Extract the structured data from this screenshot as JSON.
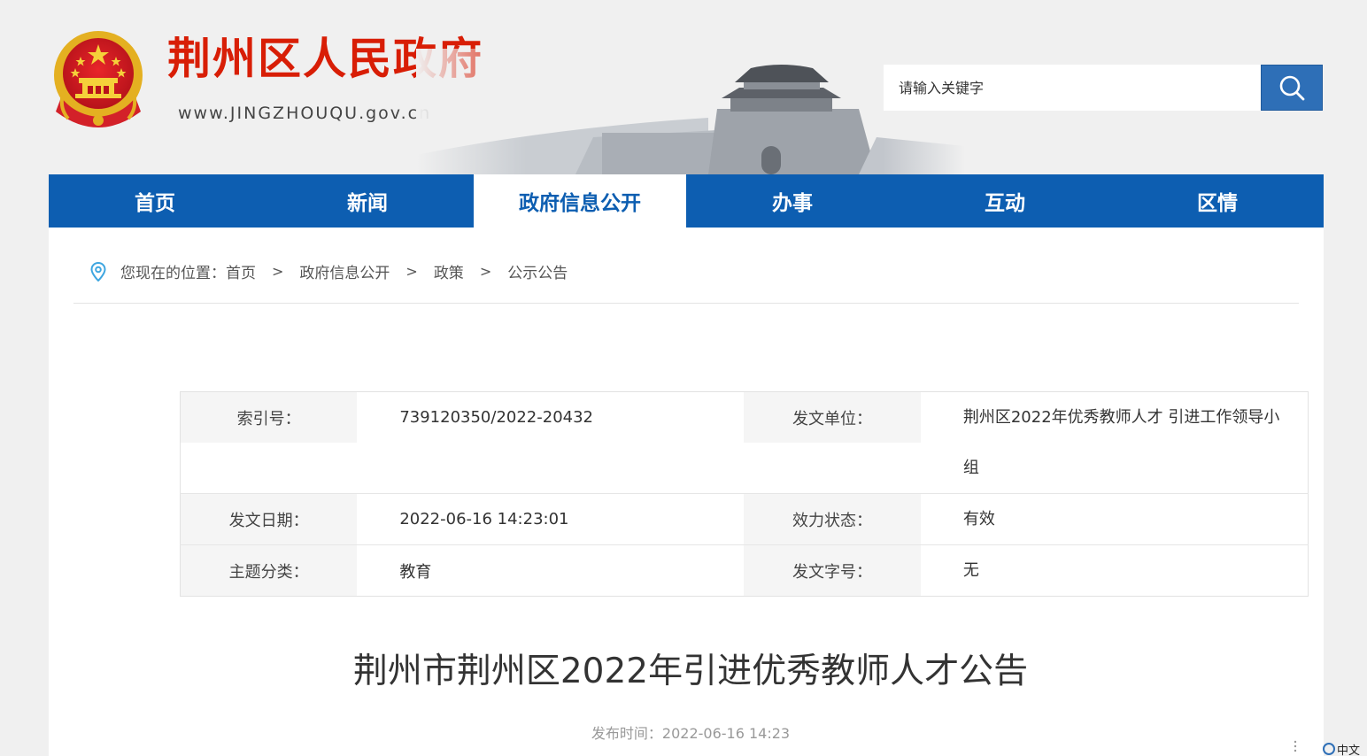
{
  "header": {
    "site_title": "荆州区人民政府",
    "site_domain": "www.JINGZHOUQU.gov.cn",
    "emblem_icon": "national-emblem-icon",
    "search": {
      "placeholder": "请输入关键字",
      "button_icon": "search-icon"
    }
  },
  "nav": {
    "items": [
      {
        "label": "首页"
      },
      {
        "label": "新闻"
      },
      {
        "label": "政府信息公开"
      },
      {
        "label": "办事"
      },
      {
        "label": "互动"
      },
      {
        "label": "区情"
      }
    ],
    "active_index": 2
  },
  "breadcrumb": {
    "prefix": "您现在的位置：",
    "items": [
      "首页",
      "政府信息公开",
      "政策",
      "公示公告"
    ],
    "separator": ">"
  },
  "meta": {
    "index_label": "索引号：",
    "index_value": "739120350/2022-20432",
    "issuer_label": "发文单位：",
    "issuer_value_line1": "荆州区2022年优秀教师人才 引进工作领导小",
    "issuer_value_line2": "组",
    "date_label": "发文日期：",
    "date_value": "2022-06-16 14:23:01",
    "status_label": "效力状态：",
    "status_value": "有效",
    "topic_label": "主题分类：",
    "topic_value": "教育",
    "docno_label": "发文字号：",
    "docno_value": "无"
  },
  "article": {
    "title": "荆州市荆州区2022年引进优秀教师人才公告",
    "publish_time": "发布时间：2022-06-16 14:23"
  },
  "ime": {
    "label": "中文"
  },
  "colors": {
    "brand_red": "#d81e06",
    "nav_blue": "#0d5eb1",
    "search_blue": "#2e6fb7"
  }
}
